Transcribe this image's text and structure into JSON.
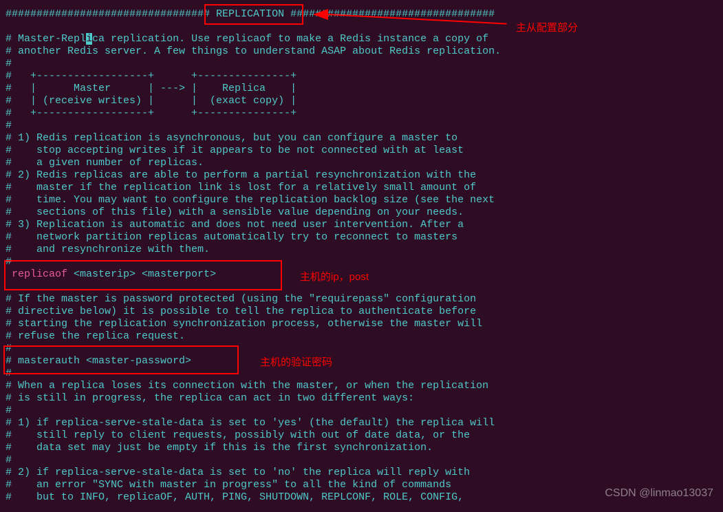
{
  "config": {
    "header_hashes_left": "################################",
    "header_label": "# REPLICATION #",
    "header_hashes_right": "################################",
    "line_prefix_master_replica": "# Master-Repl",
    "cursor_char": "i",
    "line_suffix_master_replica": "ca replication. Use replicaof to make a Redis instance a copy of",
    "line_another": "# another Redis server. A few things to understand ASAP about Redis replication.",
    "diagram_top": "#   +------------------+      +---------------+",
    "diagram_mid1": "#   |      Master      | ---> |    Replica    |",
    "diagram_mid2": "#   | (receive writes) |      |  (exact copy) |",
    "diagram_bottom": "#   +------------------+      +---------------+",
    "point1_l1": "# 1) Redis replication is asynchronous, but you can configure a master to",
    "point1_l2": "#    stop accepting writes if it appears to be not connected with at least",
    "point1_l3": "#    a given number of replicas.",
    "point2_l1": "# 2) Redis replicas are able to perform a partial resynchronization with the",
    "point2_l2": "#    master if the replication link is lost for a relatively small amount of",
    "point2_l3": "#    time. You may want to configure the replication backlog size (see the next",
    "point2_l4": "#    sections of this file) with a sensible value depending on your needs.",
    "point3_l1": "# 3) Replication is automatic and does not need user intervention. After a",
    "point3_l2": "#    network partition replicas automatically try to reconnect to masters",
    "point3_l3": "#    and resynchronize with them.",
    "replicaof_keyword": "replicaof",
    "replicaof_args": " <masterip> <masterport>",
    "if_master_l1": "# If the master is password protected (using the \"requirepass\" configuration",
    "if_master_l2": "# directive below) it is possible to tell the replica to authenticate before",
    "if_master_l3": "# starting the replication synchronization process, otherwise the master will",
    "if_master_l4": "# refuse the replica request.",
    "masterauth_line": "# masterauth <master-password>",
    "when_replica_l1": "# When a replica loses its connection with the master, or when the replication",
    "when_replica_l2": "# is still in progress, the replica can act in two different ways:",
    "serve_1_l1": "# 1) if replica-serve-stale-data is set to 'yes' (the default) the replica will",
    "serve_1_l2": "#    still reply to client requests, possibly with out of date data, or the",
    "serve_1_l3": "#    data set may just be empty if this is the first synchronization.",
    "serve_2_l1": "# 2) if replica-serve-stale-data is set to 'no' the replica will reply with",
    "serve_2_l2": "#    an error \"SYNC with master in progress\" to all the kind of commands",
    "serve_2_l3": "#    but to INFO, replicaOF, AUTH, PING, SHUTDOWN, REPLCONF, ROLE, CONFIG,",
    "hash": "#"
  },
  "annotations": {
    "top_right": "主从配置部分",
    "replicaof_note": "主机的ip，post",
    "masterauth_note": "主机的验证密码"
  },
  "watermark": "CSDN @linmao13037"
}
